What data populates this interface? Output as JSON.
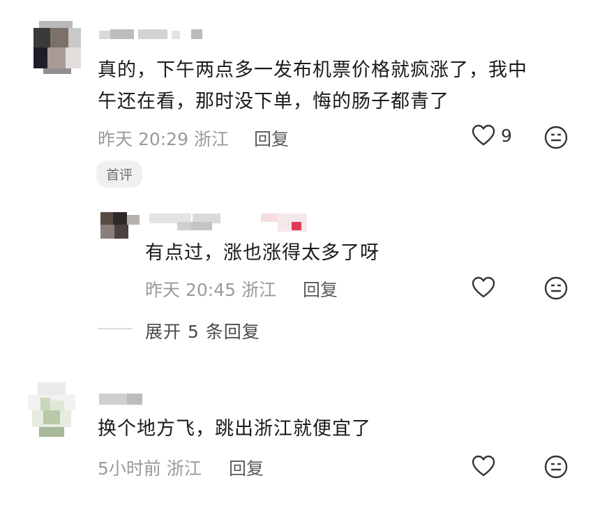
{
  "comments": [
    {
      "text_line1": "真的，下午两点多一发布机票价格就疯涨了，我中",
      "text_line2": "午还在看，那时没下单，悔的肠子都青了",
      "time": "昨天 20:29",
      "location": "浙江",
      "reply_label": "回复",
      "like_count": "9",
      "badge": "首评",
      "like_icon": "heart-outline",
      "emoji_icon": "emoji-face"
    },
    {
      "text": "有点过，涨也涨得太多了呀",
      "time": "昨天 20:45",
      "location": "浙江",
      "reply_label": "回复",
      "like_icon": "heart-outline",
      "emoji_icon": "emoji-face"
    },
    {
      "text": "换个地方飞，跳出浙江就便宜了",
      "time": "5小时前",
      "location": "浙江",
      "reply_label": "回复",
      "like_icon": "heart-outline",
      "emoji_icon": "emoji-face"
    }
  ],
  "expand_replies": "展开 5 条回复",
  "colors": {
    "text": "#1a1a1a",
    "meta": "#9a9a9a",
    "icon": "#333333",
    "badge_bg": "#f0f0f0"
  }
}
